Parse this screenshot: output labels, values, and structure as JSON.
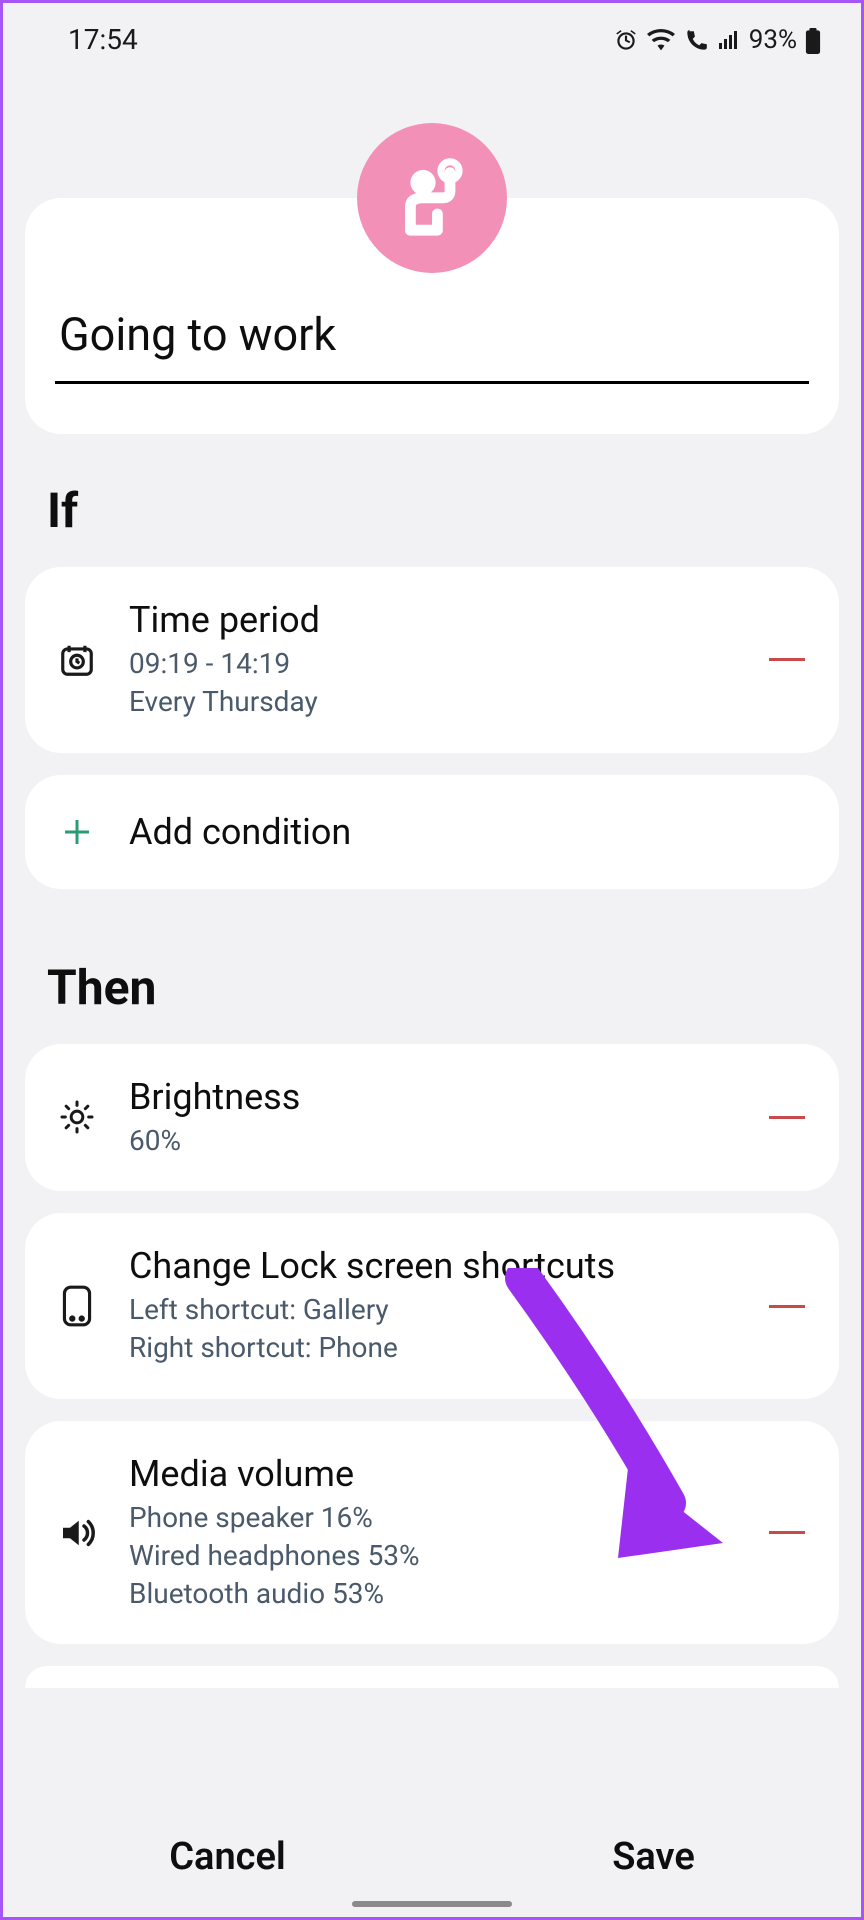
{
  "status": {
    "time": "17:54",
    "battery": "93%"
  },
  "routine": {
    "name": "Going to work"
  },
  "sections": {
    "if_label": "If",
    "then_label": "Then"
  },
  "if": {
    "time_period": {
      "title": "Time period",
      "range": "09:19 - 14:19",
      "recurrence": "Every Thursday"
    },
    "add_condition": "Add condition"
  },
  "then": {
    "brightness": {
      "title": "Brightness",
      "value": "60%"
    },
    "lock_screen": {
      "title": "Change Lock screen shortcuts",
      "left": "Left shortcut: Gallery",
      "right": "Right shortcut: Phone"
    },
    "media_volume": {
      "title": "Media volume",
      "speaker": "Phone speaker 16%",
      "wired": "Wired headphones 53%",
      "bluetooth": "Bluetooth audio 53%"
    }
  },
  "footer": {
    "cancel": "Cancel",
    "save": "Save"
  },
  "colors": {
    "avatar_bg": "#f390b8",
    "accent_remove": "#c84a4a",
    "add_plus": "#2b9b77",
    "overlay_arrow": "#9a2ff0"
  }
}
